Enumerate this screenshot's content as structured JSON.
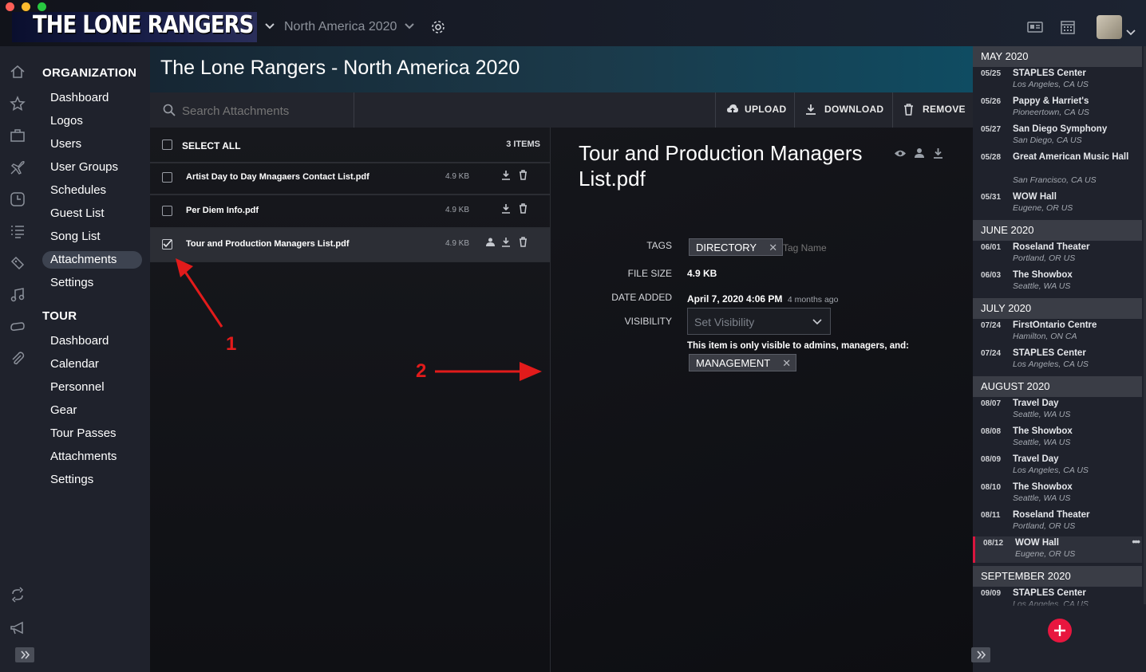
{
  "app": {
    "logo_text": "THE LONE RANGERS",
    "tour_selector": "North America 2020"
  },
  "nav": {
    "organization_heading": "ORGANIZATION",
    "organization_items": [
      "Dashboard",
      "Logos",
      "Users",
      "User Groups",
      "Schedules",
      "Guest List",
      "Song List",
      "Attachments",
      "Settings"
    ],
    "tour_heading": "TOUR",
    "tour_items": [
      "Dashboard",
      "Calendar",
      "Personnel",
      "Gear",
      "Tour Passes",
      "Attachments",
      "Settings"
    ],
    "active_item": "Attachments"
  },
  "header": {
    "title": "The Lone Rangers - North America 2020"
  },
  "toolbar": {
    "search_placeholder": "Search Attachments",
    "upload_label": "UPLOAD",
    "download_label": "DOWNLOAD",
    "remove_label": "REMOVE"
  },
  "list": {
    "select_all_label": "SELECT ALL",
    "count_label": "3 ITEMS",
    "files": [
      {
        "name": "Artist Day to Day Mnagaers Contact List.pdf",
        "size": "4.9 KB",
        "checked": false
      },
      {
        "name": "Per Diem Info.pdf",
        "size": "4.9 KB",
        "checked": false
      },
      {
        "name": "Tour and Production Managers List.pdf",
        "size": "4.9 KB",
        "checked": true
      }
    ]
  },
  "detail": {
    "title": "Tour and Production Managers List.pdf",
    "tags_label": "TAGS",
    "tag": "DIRECTORY",
    "tag_input_placeholder": "Tag Name",
    "file_size_label": "FILE SIZE",
    "file_size": "4.9 KB",
    "date_added_label": "DATE ADDED",
    "date_added": "April 7, 2020 4:06 PM",
    "date_relative": "4 months ago",
    "visibility_label": "VISIBILITY",
    "visibility_placeholder": "Set Visibility",
    "visibility_note": "This item is only visible to admins, managers, and:",
    "visibility_group": "MANAGEMENT"
  },
  "annotations": {
    "arrow1_label": "1",
    "arrow2_label": "2"
  },
  "schedule": {
    "months": [
      {
        "name": "MAY 2020",
        "events": [
          {
            "date": "05/25",
            "venue": "STAPLES Center",
            "location": "Los Angeles, CA US"
          },
          {
            "date": "05/26",
            "venue": "Pappy & Harriet's",
            "location": "Pioneertown, CA US"
          },
          {
            "date": "05/27",
            "venue": "San Diego Symphony",
            "location": "San Diego, CA US"
          },
          {
            "date": "05/28",
            "venue": "Great American Music Hall",
            "location": "San Francisco, CA US"
          },
          {
            "date": "05/31",
            "venue": "WOW Hall",
            "location": "Eugene, OR US"
          }
        ]
      },
      {
        "name": "JUNE 2020",
        "events": [
          {
            "date": "06/01",
            "venue": "Roseland Theater",
            "location": "Portland, OR US"
          },
          {
            "date": "06/03",
            "venue": "The Showbox",
            "location": "Seattle, WA US"
          }
        ]
      },
      {
        "name": "JULY 2020",
        "events": [
          {
            "date": "07/24",
            "venue": "FirstOntario Centre",
            "location": "Hamilton, ON CA"
          },
          {
            "date": "07/24",
            "venue": "STAPLES Center",
            "location": "Los Angeles, CA US"
          }
        ]
      },
      {
        "name": "AUGUST 2020",
        "events": [
          {
            "date": "08/07",
            "venue": "Travel Day",
            "location": "Seattle, WA US"
          },
          {
            "date": "08/08",
            "venue": "The Showbox",
            "location": "Seattle, WA US"
          },
          {
            "date": "08/09",
            "venue": "Travel Day",
            "location": "Los Angeles, CA US"
          },
          {
            "date": "08/10",
            "venue": "The Showbox",
            "location": "Seattle, WA US"
          },
          {
            "date": "08/11",
            "venue": "Roseland Theater",
            "location": "Portland, OR US"
          },
          {
            "date": "08/12",
            "venue": "WOW Hall",
            "location": "Eugene, OR US",
            "selected": true
          }
        ]
      },
      {
        "name": "SEPTEMBER 2020",
        "events": [
          {
            "date": "09/09",
            "venue": "STAPLES Center",
            "location": "Los Angeles, CA US"
          }
        ]
      }
    ]
  },
  "colors": {
    "accent_red": "#d9163f",
    "header_teal": "#0f4c62",
    "panel": "#1f222c"
  }
}
